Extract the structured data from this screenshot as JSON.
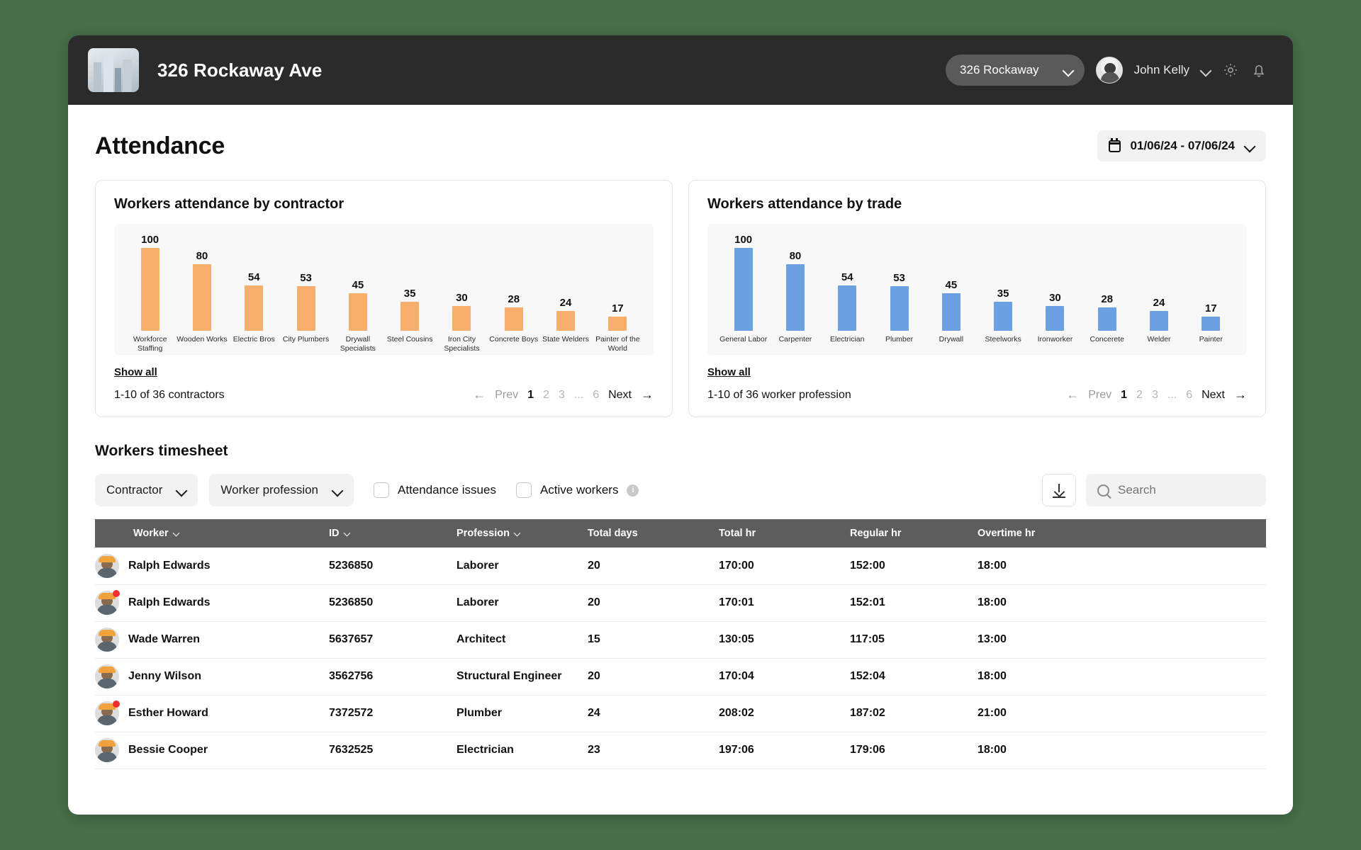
{
  "topbar": {
    "project_title": "326 Rockaway Ave",
    "project_select": "326 Rockaway",
    "user_name": "John Kelly",
    "gear_icon": "gear-icon",
    "bell_icon": "bell-icon"
  },
  "page": {
    "title": "Attendance",
    "date_range": "01/06/24 - 07/06/24"
  },
  "cards": [
    {
      "title": "Workers attendance by contractor",
      "show_all": "Show all",
      "count_label": "1-10 of 36 contractors",
      "prev": "Prev",
      "next": "Next",
      "pages": [
        "1",
        "2",
        "3",
        "...",
        "6"
      ]
    },
    {
      "title": "Workers attendance by trade",
      "show_all": "Show all",
      "count_label": "1-10 of 36 worker profession",
      "prev": "Prev",
      "next": "Next",
      "pages": [
        "1",
        "2",
        "3",
        "...",
        "6"
      ]
    }
  ],
  "chart_data": [
    {
      "type": "bar",
      "title": "Workers attendance by contractor",
      "xlabel": "",
      "ylabel": "",
      "ylim": [
        0,
        100
      ],
      "grid": false,
      "legend": "none",
      "color": "#f7ad6c",
      "categories": [
        "Workforce Staffing",
        "Wooden Works",
        "Electric Bros",
        "City Plumbers",
        "Drywall Specialists",
        "Steel Cousins",
        "Iron City Specialists",
        "Concrete Boys",
        "State Welders",
        "Painter of the World"
      ],
      "values": [
        100,
        80,
        54,
        53,
        45,
        35,
        30,
        28,
        24,
        17
      ]
    },
    {
      "type": "bar",
      "title": "Workers attendance by trade",
      "xlabel": "",
      "ylabel": "",
      "ylim": [
        0,
        100
      ],
      "grid": false,
      "legend": "none",
      "color": "#6ba1e2",
      "categories": [
        "General Labor",
        "Carpenter",
        "Electrician",
        "Plumber",
        "Drywall",
        "Steelworks",
        "Ironworker",
        "Concerete",
        "Welder",
        "Painter"
      ],
      "values": [
        100,
        80,
        54,
        53,
        45,
        35,
        30,
        28,
        24,
        17
      ]
    }
  ],
  "timesheet": {
    "title": "Workers timesheet",
    "filters": {
      "contractor": "Contractor",
      "worker_profession": "Worker profession",
      "attendance_issues": "Attendance issues",
      "active_workers": "Active workers",
      "info_glyph": "i"
    },
    "search_placeholder": "Search",
    "download_icon": "download-icon",
    "columns": [
      "Worker",
      "ID",
      "Profession",
      "Total days",
      "Total hr",
      "Regular hr",
      "Overtime hr"
    ],
    "rows": [
      {
        "worker": "Ralph Edwards",
        "id": "5236850",
        "profession": "Laborer",
        "total_days": "20",
        "total_hr": "170:00",
        "regular_hr": "152:00",
        "overtime_hr": "18:00",
        "alert": false
      },
      {
        "worker": "Ralph Edwards",
        "id": "5236850",
        "profession": "Laborer",
        "total_days": "20",
        "total_hr": "170:01",
        "regular_hr": "152:01",
        "overtime_hr": "18:00",
        "alert": true
      },
      {
        "worker": "Wade Warren",
        "id": "5637657",
        "profession": "Architect",
        "total_days": "15",
        "total_hr": "130:05",
        "regular_hr": "117:05",
        "overtime_hr": "13:00",
        "alert": false
      },
      {
        "worker": "Jenny Wilson",
        "id": "3562756",
        "profession": "Structural Engineer",
        "total_days": "20",
        "total_hr": "170:04",
        "regular_hr": "152:04",
        "overtime_hr": "18:00",
        "alert": false
      },
      {
        "worker": "Esther Howard",
        "id": "7372572",
        "profession": "Plumber",
        "total_days": "24",
        "total_hr": "208:02",
        "regular_hr": "187:02",
        "overtime_hr": "21:00",
        "alert": true
      },
      {
        "worker": "Bessie Cooper",
        "id": "7632525",
        "profession": "Electrician",
        "total_days": "23",
        "total_hr": "197:06",
        "regular_hr": "179:06",
        "overtime_hr": "18:00",
        "alert": false
      }
    ]
  },
  "colors": {
    "page_background": "#47704a",
    "topbar": "#2b2b2b",
    "bar_orange": "#f7ad6c",
    "bar_blue": "#6ba1e2",
    "table_header": "#5d5d5d",
    "alert_dot": "#f02e2e"
  }
}
